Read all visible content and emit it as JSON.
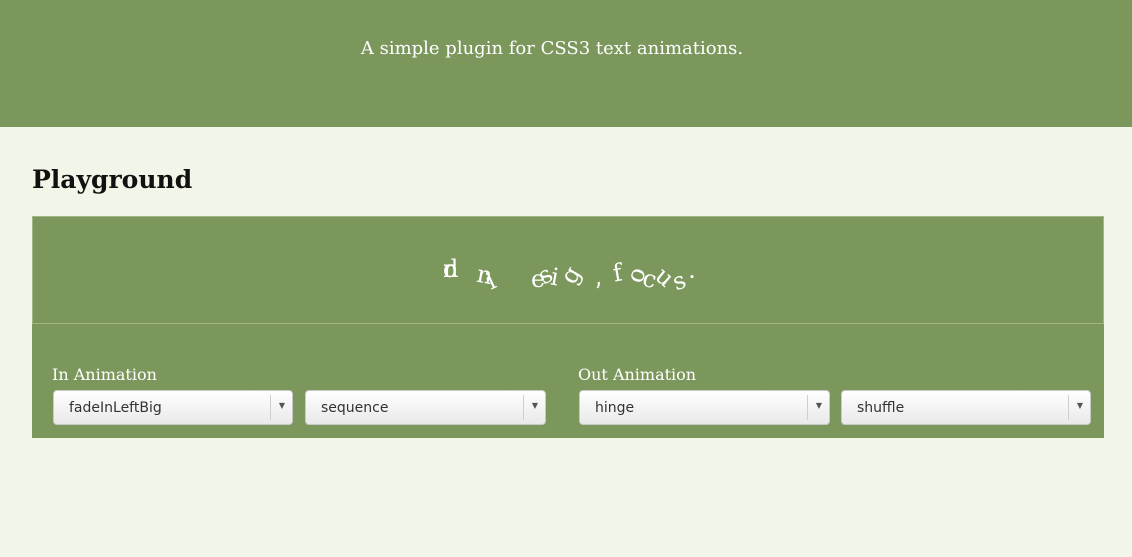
{
  "header": {
    "tagline": "A simple plugin for CSS3 text animations."
  },
  "playground": {
    "title": "Playground",
    "preview_text": "in design, focus.",
    "in_animation": {
      "label": "In Animation",
      "effect": "fadeInLeftBig",
      "type": "sequence"
    },
    "out_animation": {
      "label": "Out Animation",
      "effect": "hinge",
      "type": "shuffle"
    }
  },
  "colors": {
    "accent": "#7b975c",
    "background": "#f2f6e8"
  },
  "icons": {
    "select_arrow": "chevron-down-icon"
  }
}
